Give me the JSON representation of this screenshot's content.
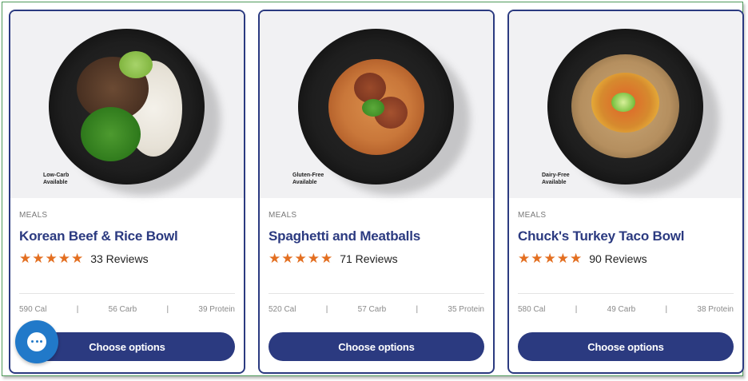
{
  "cards": [
    {
      "badge": "Low-Carb\nAvailable",
      "category": "MEALS",
      "title": "Korean Beef & Rice Bowl",
      "stars": "★★★★★",
      "reviews": "33 Reviews",
      "calories": "590 Cal",
      "carbs": "56 Carb",
      "protein": "39 Protein",
      "button": "Choose options"
    },
    {
      "badge": "Gluten-Free\nAvailable",
      "category": "MEALS",
      "title": "Spaghetti and Meatballs",
      "stars": "★★★★★",
      "reviews": "71 Reviews",
      "calories": "520 Cal",
      "carbs": "57 Carb",
      "protein": "35 Protein",
      "button": "Choose options"
    },
    {
      "badge": "Dairy-Free\nAvailable",
      "category": "MEALS",
      "title": "Chuck's Turkey Taco Bowl",
      "stars": "★★★★★",
      "reviews": "90 Reviews",
      "calories": "580 Cal",
      "carbs": "49 Carb",
      "protein": "38 Protein",
      "button": "Choose options"
    }
  ],
  "separator": "|",
  "chat_icon": "chat-bubble-icon",
  "colors": {
    "brand": "#2b3a80",
    "star": "#e36f21",
    "chat": "#2179c9"
  }
}
